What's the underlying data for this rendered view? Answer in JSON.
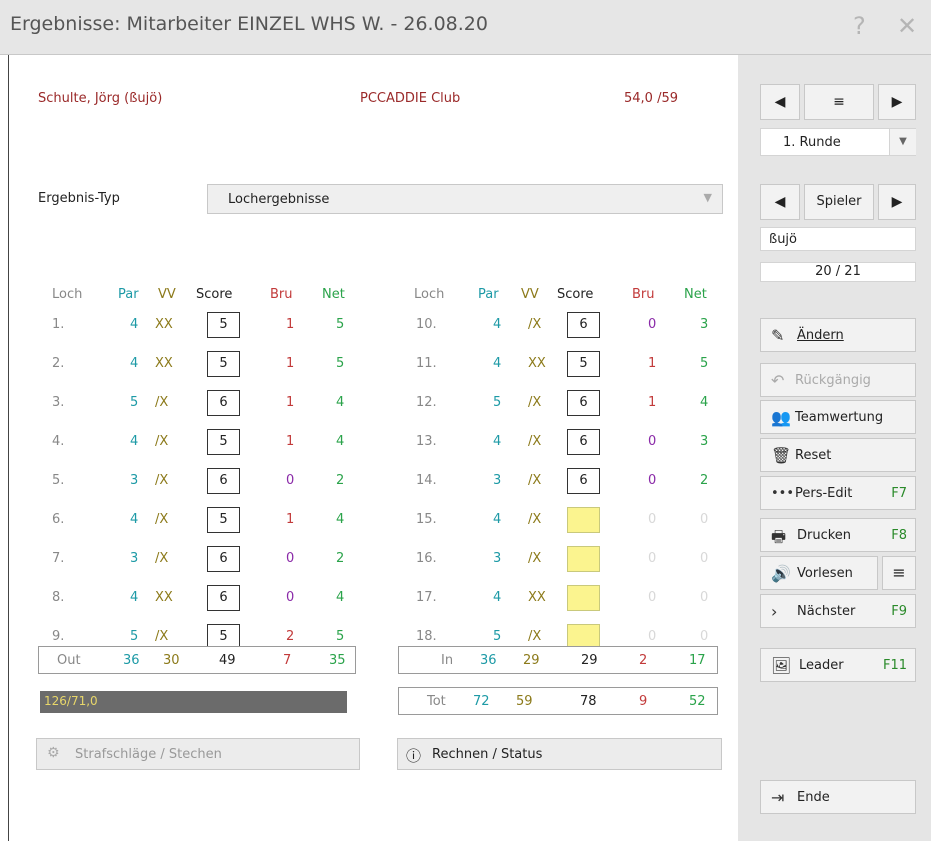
{
  "window": {
    "title": "Ergebnisse: Mitarbeiter EINZEL WHS W. - 26.08.20",
    "help_icon": "?",
    "close_icon": "✕"
  },
  "header": {
    "player_name": "Schulte, Jörg (ßujö)",
    "club": "PCCADDIE Club",
    "handicap": "54,0 /59"
  },
  "result_type": {
    "label": "Ergebnis-Typ",
    "value": "Lochergebnisse"
  },
  "columns": [
    "Loch",
    "Par",
    "VV",
    "Score",
    "Bru",
    "Net"
  ],
  "front_nine": [
    {
      "hole": "1.",
      "par": "4",
      "vv": "XX",
      "score": "5",
      "bru": "1",
      "net": "5"
    },
    {
      "hole": "2.",
      "par": "4",
      "vv": "XX",
      "score": "5",
      "bru": "1",
      "net": "5"
    },
    {
      "hole": "3.",
      "par": "5",
      "vv": "/X",
      "score": "6",
      "bru": "1",
      "net": "4"
    },
    {
      "hole": "4.",
      "par": "4",
      "vv": "/X",
      "score": "5",
      "bru": "1",
      "net": "4"
    },
    {
      "hole": "5.",
      "par": "3",
      "vv": "/X",
      "score": "6",
      "bru": "0",
      "net": "2"
    },
    {
      "hole": "6.",
      "par": "4",
      "vv": "/X",
      "score": "5",
      "bru": "1",
      "net": "4"
    },
    {
      "hole": "7.",
      "par": "3",
      "vv": "/X",
      "score": "6",
      "bru": "0",
      "net": "2"
    },
    {
      "hole": "8.",
      "par": "4",
      "vv": "XX",
      "score": "6",
      "bru": "0",
      "net": "4"
    },
    {
      "hole": "9.",
      "par": "5",
      "vv": "/X",
      "score": "5",
      "bru": "2",
      "net": "5"
    }
  ],
  "back_nine": [
    {
      "hole": "10.",
      "par": "4",
      "vv": "/X",
      "score": "6",
      "bru": "0",
      "net": "3"
    },
    {
      "hole": "11.",
      "par": "4",
      "vv": "XX",
      "score": "5",
      "bru": "1",
      "net": "5"
    },
    {
      "hole": "12.",
      "par": "5",
      "vv": "/X",
      "score": "6",
      "bru": "1",
      "net": "4"
    },
    {
      "hole": "13.",
      "par": "4",
      "vv": "/X",
      "score": "6",
      "bru": "0",
      "net": "3"
    },
    {
      "hole": "14.",
      "par": "3",
      "vv": "/X",
      "score": "6",
      "bru": "0",
      "net": "2"
    },
    {
      "hole": "15.",
      "par": "4",
      "vv": "/X",
      "score": "",
      "bru": "0",
      "net": "0"
    },
    {
      "hole": "16.",
      "par": "3",
      "vv": "/X",
      "score": "",
      "bru": "0",
      "net": "0"
    },
    {
      "hole": "17.",
      "par": "4",
      "vv": "XX",
      "score": "",
      "bru": "0",
      "net": "0"
    },
    {
      "hole": "18.",
      "par": "5",
      "vv": "/X",
      "score": "",
      "bru": "0",
      "net": "0"
    }
  ],
  "totals": {
    "out": {
      "label": "Out",
      "par": "36",
      "vv": "30",
      "score": "49",
      "bru": "7",
      "net": "35"
    },
    "in": {
      "label": "In",
      "par": "36",
      "vv": "29",
      "score": "29",
      "bru": "2",
      "net": "17"
    },
    "tot": {
      "label": "Tot",
      "par": "72",
      "vv": "59",
      "score": "78",
      "bru": "9",
      "net": "52"
    }
  },
  "progress_text": "126/71,0",
  "buttons": {
    "penalty": "Strafschläge / Stechen",
    "calc_status": "Rechnen / Status"
  },
  "right_panel": {
    "round_select": "1. Runde",
    "player_nav_label": "Spieler",
    "player_short": "ßujö",
    "player_count": "20 / 21",
    "actions": [
      {
        "label": "Ändern",
        "key": ""
      },
      {
        "label": "Rückgängig",
        "key": ""
      },
      {
        "label": "Teamwertung",
        "key": ""
      },
      {
        "label": "Reset",
        "key": ""
      },
      {
        "label": "Pers-Edit",
        "key": "F7"
      },
      {
        "label": "Drucken",
        "key": "F8"
      },
      {
        "label": "Vorlesen",
        "key": ""
      },
      {
        "label": "Nächster",
        "key": "F9"
      },
      {
        "label": "Leader",
        "key": "F11"
      },
      {
        "label": "Ende",
        "key": ""
      }
    ]
  },
  "colors": {
    "name_red": "#9a2929",
    "par_teal": "#1d9aa6",
    "vv_olive": "#8c7a1a",
    "bru_red": "#c23a3a",
    "net_green": "#2aa34a",
    "empty_score_yellow": "#fbf48f"
  }
}
